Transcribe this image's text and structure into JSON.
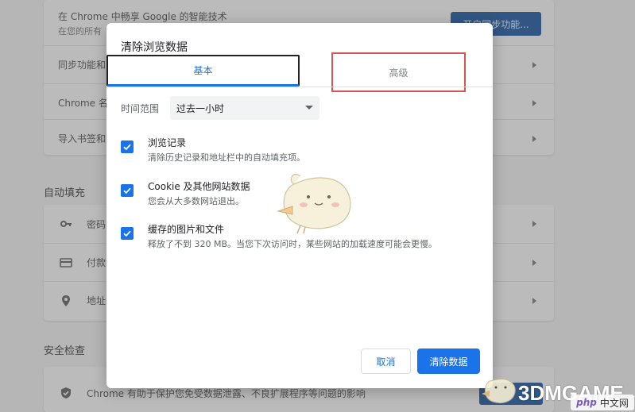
{
  "background": {
    "sync_card": {
      "line1": "在 Chrome 中畅享 Google 的智能技术",
      "line2": "在您的所有",
      "button_label": "开启同步功能...",
      "rows": [
        "同步功能和",
        "Chrome 名",
        "导入书签和"
      ]
    },
    "autofill": {
      "section_title": "自动填充",
      "rows": [
        {
          "icon": "key-icon",
          "label": "密码"
        },
        {
          "icon": "credit-card-icon",
          "label": "付款"
        },
        {
          "icon": "location-pin-icon",
          "label": "地址"
        }
      ]
    },
    "safety": {
      "section_title": "安全检查",
      "row_text": "Chrome 有助于保护您免受数据泄露、不良扩展程序等问题的影响"
    }
  },
  "dialog": {
    "title": "清除浏览数据",
    "tabs": [
      {
        "label": "基本",
        "selected": true
      },
      {
        "label": "高级",
        "selected": false
      }
    ],
    "time_range": {
      "label": "时间范围",
      "value": "过去一小时"
    },
    "options": [
      {
        "title": "浏览记录",
        "desc": "清除历史记录和地址栏中的自动填充项。",
        "checked": true
      },
      {
        "title": "Cookie 及其他网站数据",
        "desc": "您会从大多数网站退出。",
        "checked": true
      },
      {
        "title": "缓存的图片和文件",
        "desc": "释放了不到 320 MB。当您下次访问时，某些网站的加载速度可能会更慢。",
        "checked": true
      }
    ],
    "buttons": {
      "cancel": "取消",
      "clear": "清除数据"
    }
  },
  "watermark": {
    "brand": "3DMGAME",
    "site_php": "php",
    "site_cn": "中文网"
  },
  "colors": {
    "accent": "#1a73e8",
    "highlight_box": "#d9534f"
  }
}
